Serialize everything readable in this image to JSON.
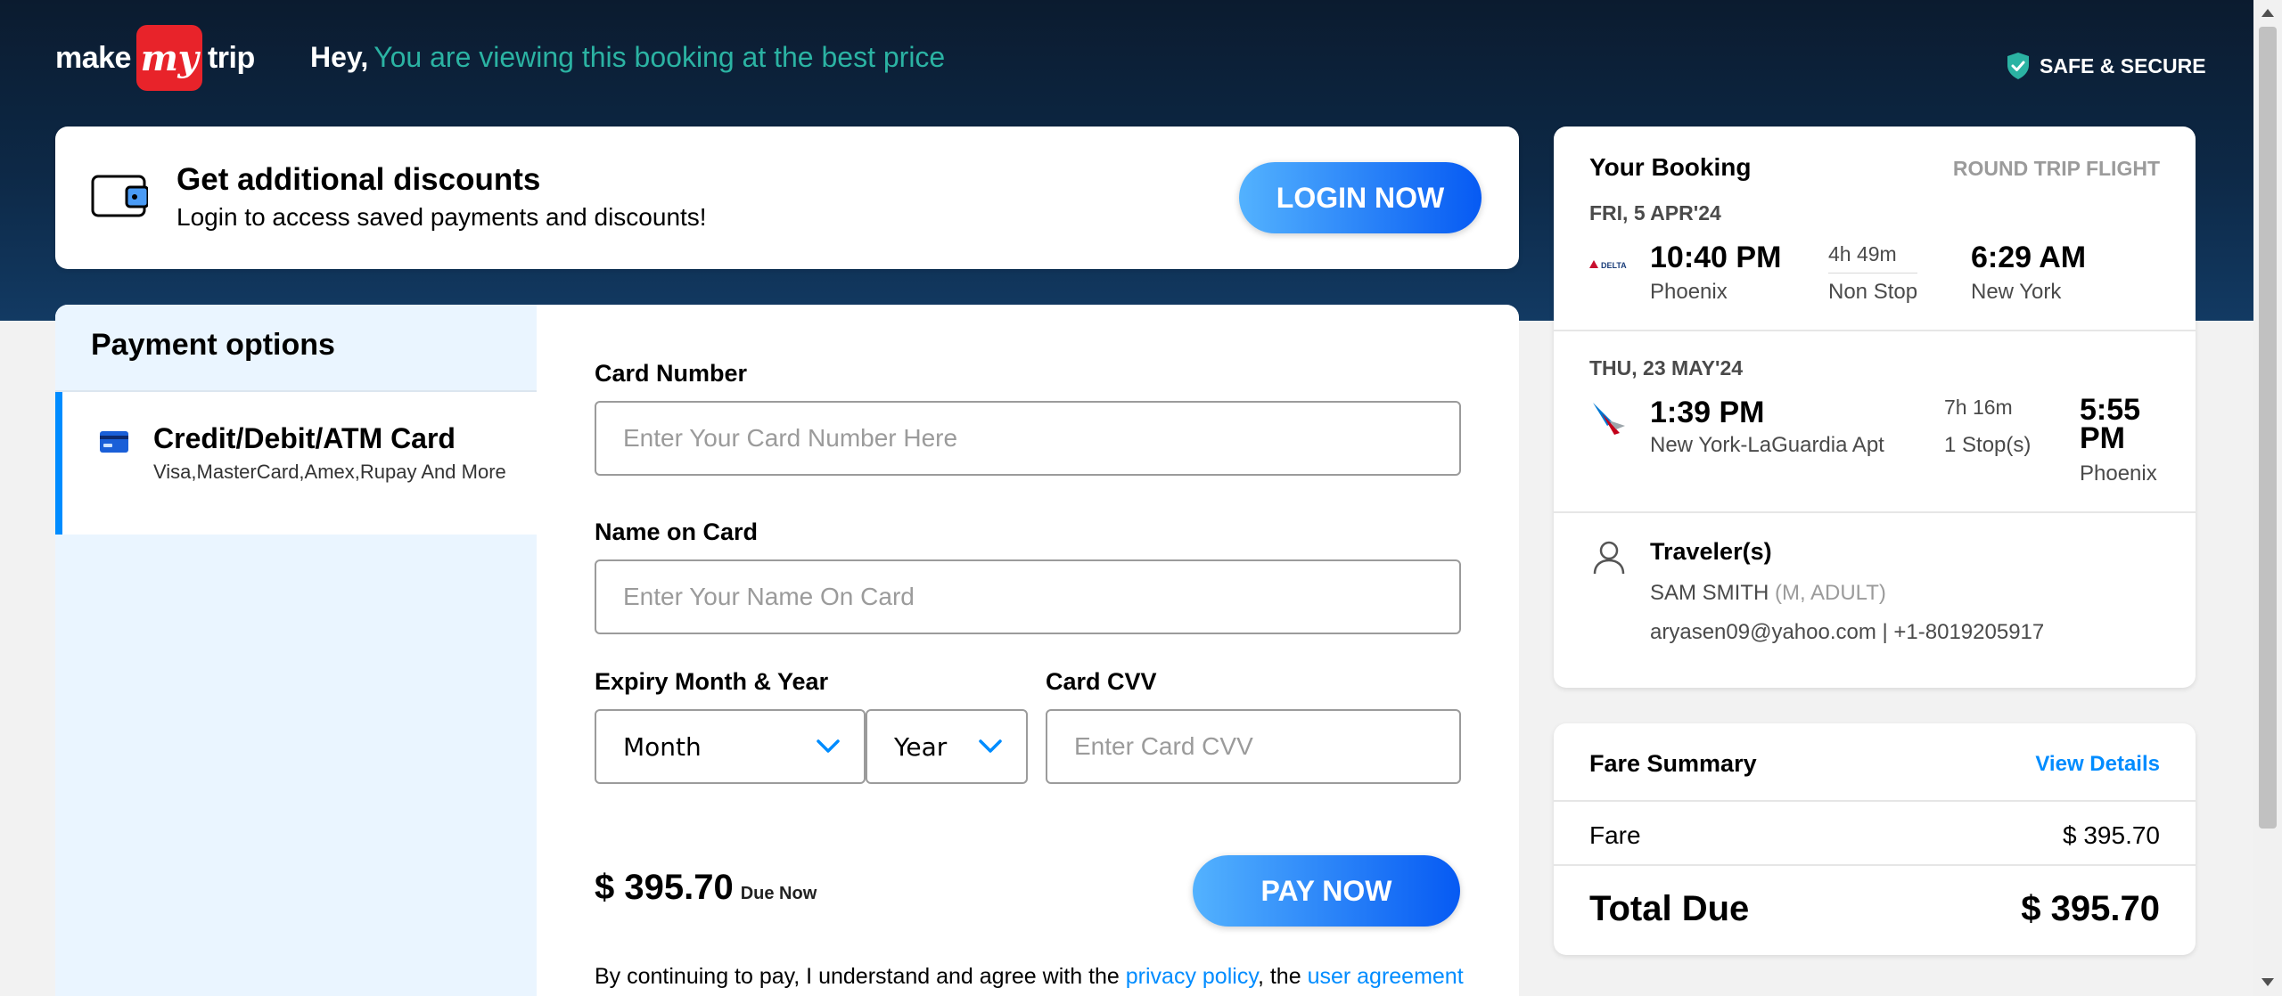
{
  "header": {
    "logo": {
      "make": "make",
      "my": "my",
      "trip": "trip"
    },
    "greeting": "Hey,",
    "greeting_highlight": "You are viewing this booking at the best price",
    "safe_label": "SAFE & SECURE"
  },
  "discount": {
    "title": "Get additional discounts",
    "subtitle": "Login to access saved payments and discounts!",
    "login_button": "LOGIN NOW"
  },
  "payment": {
    "options_title": "Payment options",
    "option": {
      "title": "Credit/Debit/ATM Card",
      "subtitle": "Visa,MasterCard,Amex,Rupay And More"
    },
    "card_number_label": "Card Number",
    "card_number_placeholder": "Enter Your Card Number Here",
    "name_label": "Name on Card",
    "name_placeholder": "Enter Your Name On Card",
    "expiry_label": "Expiry Month & Year",
    "month_value": "Month",
    "year_value": "Year",
    "cvv_label": "Card CVV",
    "cvv_placeholder": "Enter Card CVV",
    "amount": "$ 395.70",
    "due_label": "Due Now",
    "pay_button": "PAY NOW",
    "terms_prefix": "By continuing to pay, I understand and agree with the ",
    "privacy_link": "privacy policy",
    "terms_mid": ", the ",
    "agreement_link": "user agreement"
  },
  "booking": {
    "title": "Your Booking",
    "trip_type": "ROUND TRIP FLIGHT",
    "outbound": {
      "date": "FRI, 5 APR'24",
      "airline_logo": "delta-logo",
      "airline_text": "DELTA",
      "depart_time": "10:40 PM",
      "depart_city": "Phoenix",
      "duration": "4h 49m",
      "stops": "Non Stop",
      "arrive_time": "6:29 AM",
      "arrive_city": "New York"
    },
    "return": {
      "date": "THU, 23 MAY'24",
      "airline_logo": "american-airlines-logo",
      "depart_time": "1:39 PM",
      "depart_city": "New York-LaGuardia Apt",
      "duration": "7h 16m",
      "stops": "1 Stop(s)",
      "arrive_time_line1": "5:55",
      "arrive_time_line2": "PM",
      "arrive_city": "Phoenix"
    },
    "travelers_title": "Traveler(s)",
    "traveler_name": "SAM SMITH",
    "traveler_meta": "(M, ADULT)",
    "traveler_contact": "aryasen09@yahoo.com | +1-8019205917"
  },
  "fare": {
    "title": "Fare Summary",
    "view_details": "View Details",
    "fare_label": "Fare",
    "fare_value": "$ 395.70",
    "total_label": "Total Due",
    "total_value": "$ 395.70"
  },
  "colors": {
    "header_bg": "#0d2947",
    "accent_blue": "#008cff",
    "highlight_teal": "#2bb3a3",
    "logo_red": "#e8232a",
    "side_panel": "#eaf5ff"
  }
}
